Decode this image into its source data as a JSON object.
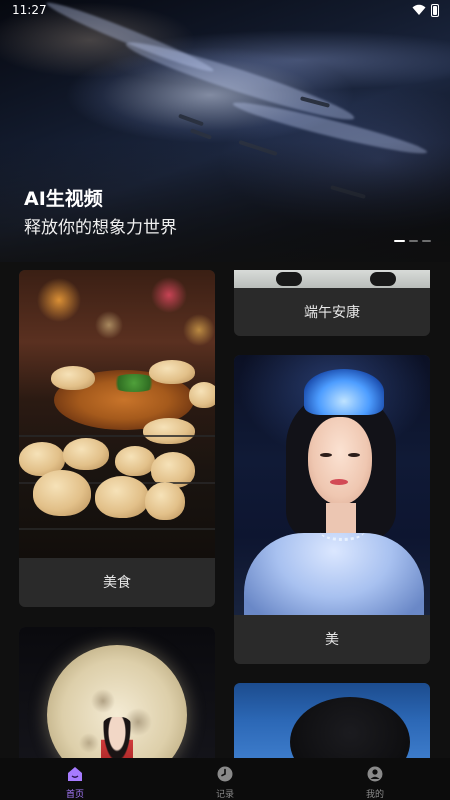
{
  "status_bar": {
    "time": "11:27"
  },
  "banner": {
    "title": "AI生视频",
    "subtitle": "释放你的想象力世界",
    "slide_count": 3,
    "active_slide": 1
  },
  "cards": {
    "food": {
      "label": "美食"
    },
    "dragon_boat": {
      "label": "端午安康"
    },
    "beauty": {
      "label": "美"
    }
  },
  "tabbar": {
    "items": [
      {
        "label": "首页",
        "icon": "home-icon",
        "active": true
      },
      {
        "label": "记录",
        "icon": "clock-icon",
        "active": false
      },
      {
        "label": "我的",
        "icon": "profile-icon",
        "active": false
      }
    ]
  },
  "colors": {
    "background": "#101010",
    "card": "#2a2a2a",
    "accent": "#a77bff"
  }
}
